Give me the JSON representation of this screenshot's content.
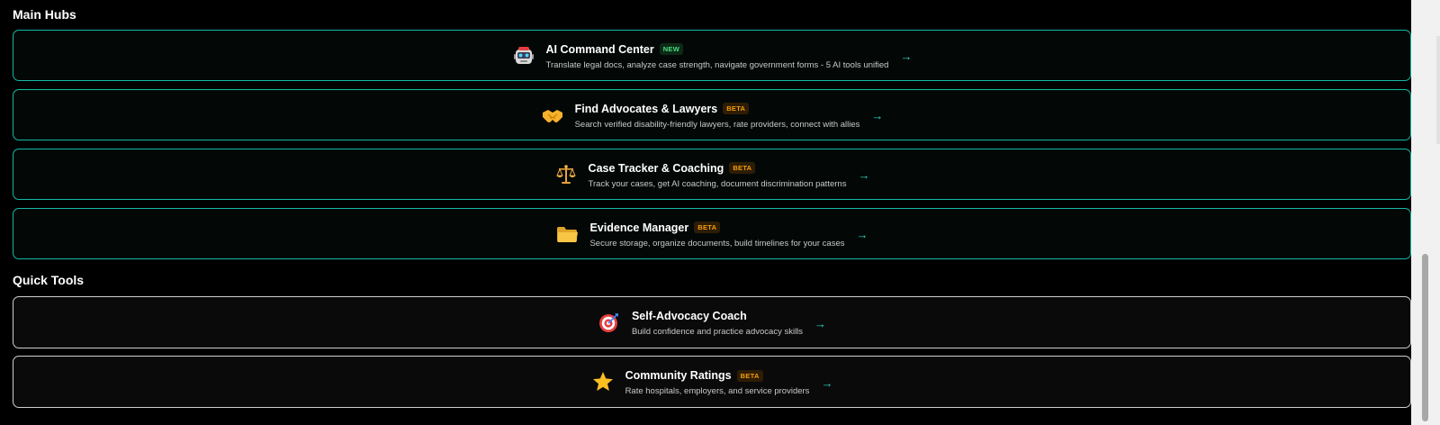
{
  "main_hubs": {
    "heading": "Main Hubs",
    "items": [
      {
        "icon": "robot-icon",
        "title": "AI Command Center",
        "badge": "NEW",
        "badge_kind": "new",
        "description": "Translate legal docs, analyze case strength, navigate government forms - 5 AI tools unified",
        "arrow": "→"
      },
      {
        "icon": "handshake-icon",
        "title": "Find Advocates & Lawyers",
        "badge": "BETA",
        "badge_kind": "beta",
        "description": "Search verified disability-friendly lawyers, rate providers, connect with allies",
        "arrow": "→"
      },
      {
        "icon": "scales-icon",
        "title": "Case Tracker & Coaching",
        "badge": "BETA",
        "badge_kind": "beta",
        "description": "Track your cases, get AI coaching, document discrimination patterns",
        "arrow": "→"
      },
      {
        "icon": "folder-icon",
        "title": "Evidence Manager",
        "badge": "BETA",
        "badge_kind": "beta",
        "description": "Secure storage, organize documents, build timelines for your cases",
        "arrow": "→"
      }
    ]
  },
  "quick_tools": {
    "heading": "Quick Tools",
    "items": [
      {
        "icon": "target-icon",
        "title": "Self-Advocacy Coach",
        "description": "Build confidence and practice advocacy skills",
        "arrow": "→"
      },
      {
        "icon": "star-icon",
        "title": "Community Ratings",
        "badge": "BETA",
        "badge_kind": "beta",
        "description": "Rate hospitals, employers, and service providers",
        "arrow": "→"
      }
    ]
  },
  "colors": {
    "background": "#000000",
    "hub_border": "#14b8a6",
    "tool_border": "#cfcfcf",
    "arrow": "#2dd4bf",
    "badge_new": "#4ade80",
    "badge_beta": "#f59e0b"
  }
}
